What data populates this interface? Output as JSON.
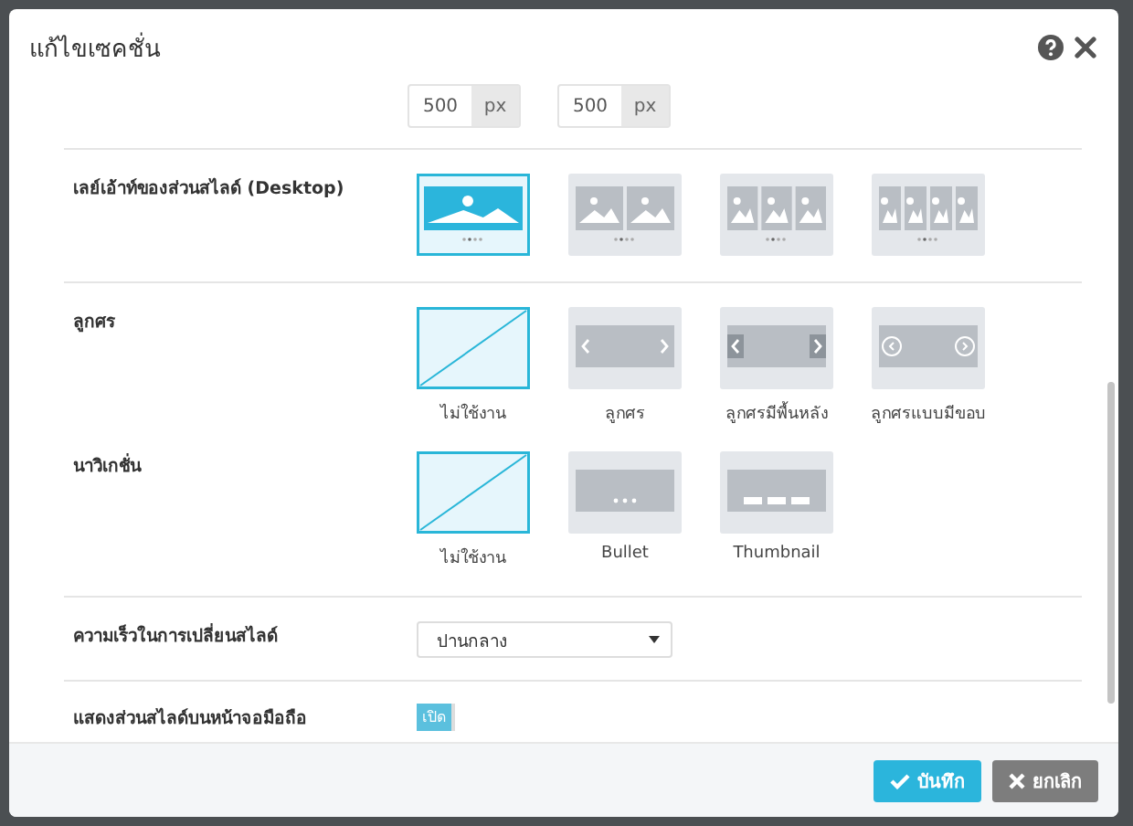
{
  "dialog": {
    "title": "แก้ไขเซคชั่น"
  },
  "size_fields": [
    {
      "value": "500",
      "unit": "px"
    },
    {
      "value": "500",
      "unit": "px"
    }
  ],
  "sections": [
    {
      "label": "เลย์เอ้าท์ของส่วนสไลด์ (Desktop)",
      "options": [
        {
          "kind": "single",
          "selected": true
        },
        {
          "kind": "double",
          "selected": false
        },
        {
          "kind": "triple",
          "selected": false
        },
        {
          "kind": "quad",
          "selected": false
        }
      ]
    },
    {
      "label": "ลูกศร",
      "options": [
        {
          "kind": "none",
          "caption": "ไม่ใช้งาน",
          "selected": true
        },
        {
          "kind": "plain",
          "caption": "ลูกศร",
          "selected": false
        },
        {
          "kind": "filled",
          "caption": "ลูกศรมีพื้นหลัง",
          "selected": false
        },
        {
          "kind": "circled",
          "caption": "ลูกศรแบบมีขอบ",
          "selected": false
        }
      ]
    },
    {
      "label": "นาวิเกชั่น",
      "options": [
        {
          "kind": "none",
          "caption": "ไม่ใช้งาน",
          "selected": true
        },
        {
          "kind": "bullet",
          "caption": "Bullet",
          "selected": false
        },
        {
          "kind": "thumbnail",
          "caption": "Thumbnail",
          "selected": false
        }
      ]
    }
  ],
  "speed": {
    "label": "ความเร็วในการเปลี่ยนสไลด์",
    "value": "ปานกลาง"
  },
  "mobile": {
    "label": "แสดงส่วนสไลด์บนหน้าจอมือถือ",
    "toggle_text": "เปิด",
    "on": true
  },
  "buttons": [
    {
      "kind": "save",
      "label": "บันทึก"
    },
    {
      "kind": "cancel",
      "label": "ยกเลิก"
    }
  ]
}
